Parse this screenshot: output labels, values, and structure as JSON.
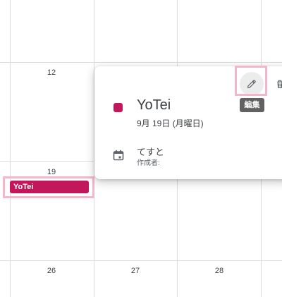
{
  "calendar": {
    "day_numbers": [
      "12",
      "19",
      "26",
      "27",
      "28"
    ]
  },
  "event_chip": {
    "label": "YoTei",
    "color": "#c2185b"
  },
  "popup": {
    "title": "YoTei",
    "date": "9月 19日 (月曜日)",
    "calendar_name": "てすと",
    "creator_label": "作成者:",
    "color": "#c2185b",
    "edit_icon": "pencil-icon",
    "delete_icon": "trash-icon",
    "calendar_icon": "calendar-icon"
  },
  "tooltip": {
    "text": "編集"
  },
  "highlight_color": "#f4b6cc"
}
